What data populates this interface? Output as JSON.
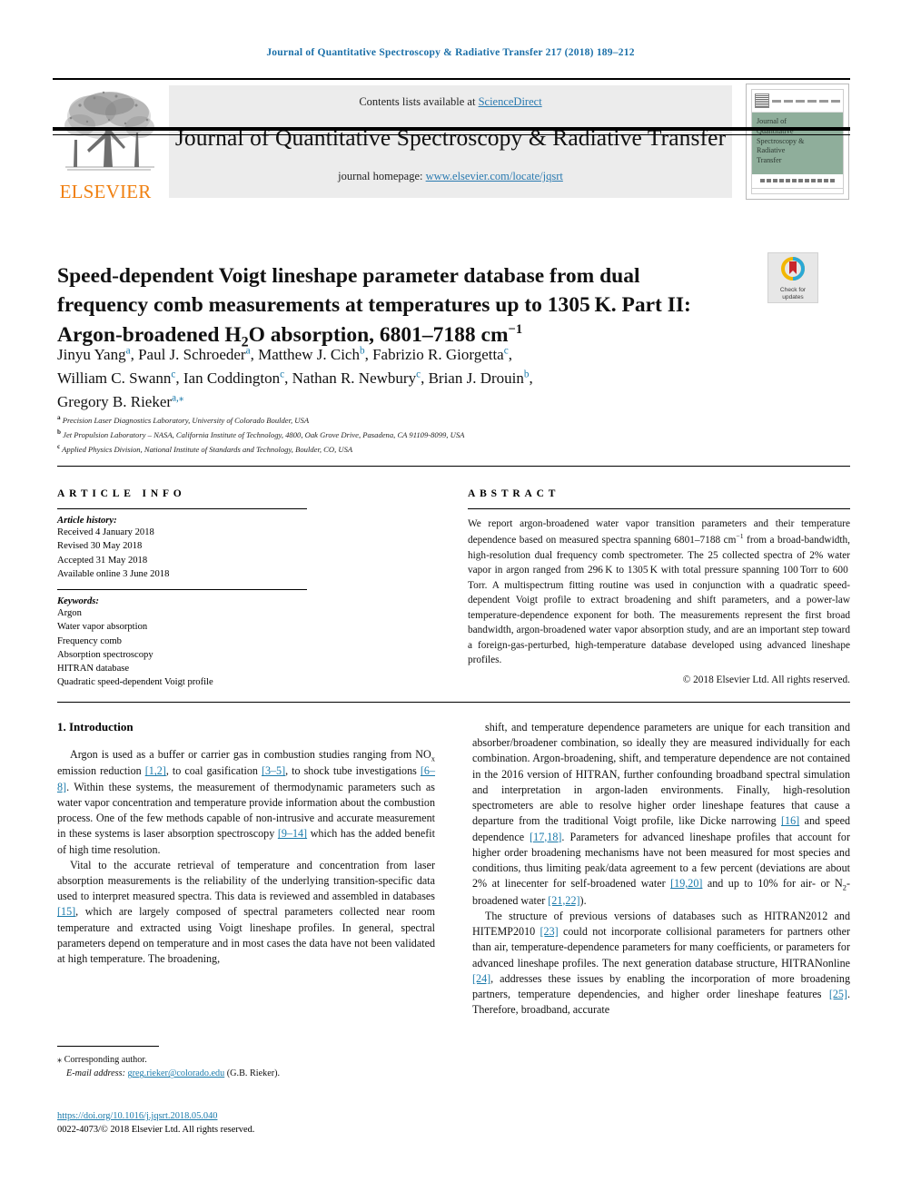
{
  "running_head": "Journal of Quantitative Spectroscopy & Radiative Transfer 217 (2018) 189–212",
  "masthead": {
    "contents_prefix": "Contents lists available at ",
    "sciencedirect": "ScienceDirect",
    "journal_name": "Journal of Quantitative Spectroscopy & Radiative Transfer",
    "homepage_prefix": "journal homepage: ",
    "homepage_url": "www.elsevier.com/locate/jqsrt",
    "publisher": "ELSEVIER",
    "cover": {
      "line1": "Journal of",
      "line2": "Quantitative",
      "line3": "Spectroscopy &",
      "line4": "Radiative",
      "line5": "Transfer"
    }
  },
  "crossmark": {
    "line1": "Check for",
    "line2": "updates"
  },
  "article": {
    "title_line1": "Speed-dependent Voigt lineshape parameter database from dual",
    "title_line2_a": "frequency comb measurements at temperatures up to 1305 K. Part II:",
    "title_line3_a": "Argon-broadened H",
    "title_line3_sub": "2",
    "title_line3_b": "O absorption, 6801–7188 cm",
    "title_line3_sup": "−1",
    "authors": [
      {
        "name": "Jinyu Yang",
        "sup": "a",
        "sep": ", "
      },
      {
        "name": "Paul J. Schroeder",
        "sup": "a",
        "sep": ", "
      },
      {
        "name": "Matthew J. Cich",
        "sup": "b",
        "sep": ", "
      },
      {
        "name": "Fabrizio R. Giorgetta",
        "sup": "c",
        "sep": ","
      },
      {
        "name": "William C. Swann",
        "sup": "c",
        "sep": ", "
      },
      {
        "name": "Ian Coddington",
        "sup": "c",
        "sep": ", "
      },
      {
        "name": "Nathan R. Newbury",
        "sup": "c",
        "sep": ", "
      },
      {
        "name": "Brian J. Drouin",
        "sup": "b",
        "sep": ","
      },
      {
        "name": "Gregory B. Rieker",
        "sup": "a,⁎",
        "sep": ""
      }
    ],
    "affiliations": [
      {
        "marker": "a",
        "text": "Precision Laser Diagnostics Laboratory, University of Colorado Boulder, USA"
      },
      {
        "marker": "b",
        "text": "Jet Propulsion Laboratory – NASA, California Institute of Technology, 4800, Oak Grove Drive, Pasadena, CA 91109-8099, USA"
      },
      {
        "marker": "c",
        "text": "Applied Physics Division, National Institute of Standards and Technology, Boulder, CO, USA"
      }
    ]
  },
  "article_info": {
    "heading": "ARTICLE INFO",
    "history_heading": "Article history:",
    "history": [
      "Received 4 January 2018",
      "Revised 30 May 2018",
      "Accepted 31 May 2018",
      "Available online 3 June 2018"
    ],
    "keywords_heading": "Keywords:",
    "keywords": [
      "Argon",
      "Water vapor absorption",
      "Frequency comb",
      "Absorption spectroscopy",
      "HITRAN database",
      "Quadratic speed-dependent Voigt profile"
    ]
  },
  "abstract": {
    "heading": "ABSTRACT",
    "part1": "We report argon-broadened water vapor transition parameters and their temperature dependence based on measured spectra spanning 6801–7188 cm",
    "sup": "−1",
    "part2": " from a broad-bandwidth, high-resolution dual frequency comb spectrometer. The 25 collected spectra of 2% water vapor in argon ranged from 296 K to 1305 K with total pressure spanning 100 Torr to 600 Torr. A multispectrum fitting routine was used in conjunction with a quadratic speed-dependent Voigt profile to extract broadening and shift parameters, and a power-law temperature-dependence exponent for both. The measurements represent the first broad bandwidth, argon-broadened water vapor absorption study, and are an important step toward a foreign-gas-perturbed, high-temperature database developed using advanced lineshape profiles.",
    "copyright": "© 2018 Elsevier Ltd. All rights reserved."
  },
  "body": {
    "section_title": "1. Introduction",
    "left_paragraphs": [
      {
        "segments": [
          {
            "t": "Argon is used as a buffer or carrier gas in combustion studies ranging from NO"
          },
          {
            "t": "x",
            "style": "sub"
          },
          {
            "t": " emission reduction "
          },
          {
            "t": "[1,2]",
            "style": "ref"
          },
          {
            "t": ", to coal gasification "
          },
          {
            "t": "[3–5]",
            "style": "ref"
          },
          {
            "t": ", to shock tube investigations "
          },
          {
            "t": "[6–8]",
            "style": "ref"
          },
          {
            "t": ". Within these systems, the measurement of thermodynamic parameters such as water vapor concentration and temperature provide information about the combustion process. One of the few methods capable of non-intrusive and accurate measurement in these systems is laser absorption spectroscopy "
          },
          {
            "t": "[9–14]",
            "style": "ref"
          },
          {
            "t": " which has the added benefit of high time resolution."
          }
        ]
      },
      {
        "segments": [
          {
            "t": "Vital to the accurate retrieval of temperature and concentration from laser absorption measurements is the reliability of the underlying transition-specific data used to interpret measured spectra. This data is reviewed and assembled in databases "
          },
          {
            "t": "[15]",
            "style": "ref"
          },
          {
            "t": ", which are largely composed of spectral parameters collected near room temperature and extracted using Voigt lineshape profiles. In general, spectral parameters depend on temperature and in most cases the data have not been validated at high temperature. The broadening,"
          }
        ]
      }
    ],
    "right_paragraphs": [
      {
        "segments": [
          {
            "t": "shift, and temperature dependence parameters are unique for each transition and absorber/broadener combination, so ideally they are measured individually for each combination. Argon-broadening, shift, and temperature dependence are not contained in the 2016 version of HITRAN, further confounding broadband spectral simulation and interpretation in argon-laden environments. Finally, high-resolution spectrometers are able to resolve higher order lineshape features that cause a departure from the traditional Voigt profile, like Dicke narrowing "
          },
          {
            "t": "[16]",
            "style": "ref"
          },
          {
            "t": " and speed dependence "
          },
          {
            "t": "[17,18]",
            "style": "ref"
          },
          {
            "t": ". Parameters for advanced lineshape profiles that account for higher order broadening mechanisms have not been measured for most species and conditions, thus limiting peak/data agreement to a few percent (deviations are about 2% at linecenter for self-broadened water "
          },
          {
            "t": "[19,20]",
            "style": "ref"
          },
          {
            "t": " and up to 10% for air- or N"
          },
          {
            "t": "2",
            "style": "sub"
          },
          {
            "t": "-broadened water "
          },
          {
            "t": "[21,22]",
            "style": "ref"
          },
          {
            "t": ")."
          }
        ],
        "noindent": false
      },
      {
        "segments": [
          {
            "t": "The structure of previous versions of databases such as HITRAN2012 and HITEMP2010 "
          },
          {
            "t": "[23]",
            "style": "ref"
          },
          {
            "t": " could not incorporate collisional parameters for partners other than air, temperature-dependence parameters for many coefficients, or parameters for advanced lineshape profiles. The next generation database structure, HITRANonline "
          },
          {
            "t": "[24]",
            "style": "ref"
          },
          {
            "t": ", addresses these issues by enabling the incorporation of more broadening partners, temperature dependencies, and higher order lineshape features "
          },
          {
            "t": "[25]",
            "style": "ref"
          },
          {
            "t": ". Therefore, broadband, accurate"
          }
        ],
        "noindent": false
      }
    ]
  },
  "footnote": {
    "star": "⁎",
    "corresponding": "Corresponding author.",
    "email_label": "E-mail address:",
    "email": "greg.rieker@colorado.edu",
    "email_owner": "(G.B. Rieker)."
  },
  "footer": {
    "doi": "https://doi.org/10.1016/j.jqsrt.2018.05.040",
    "issn_line": "0022-4073/© 2018 Elsevier Ltd. All rights reserved."
  },
  "colors": {
    "link": "#1a7aab",
    "running_head": "#1a6fa8",
    "elsevier_orange": "#f08010",
    "cover_green": "#8fae9b"
  }
}
